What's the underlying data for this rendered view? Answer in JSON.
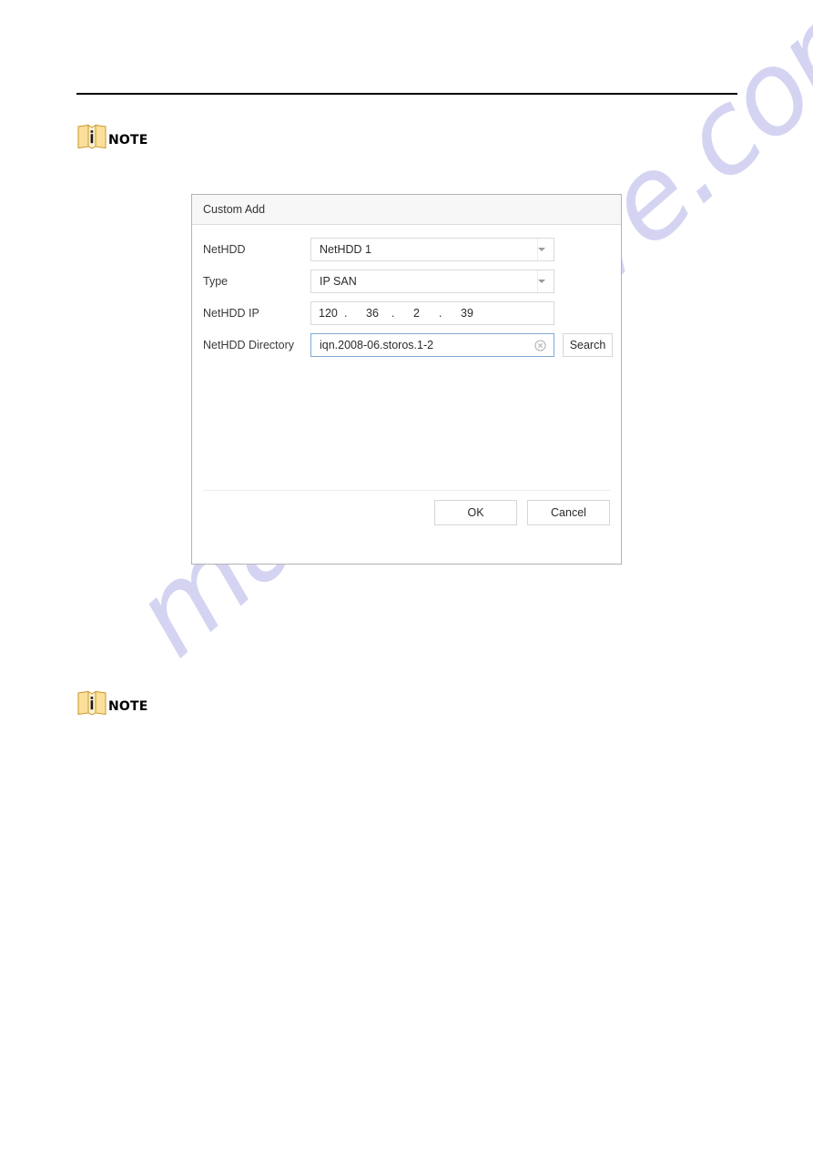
{
  "page": {
    "notes": [
      {
        "id": "note-1",
        "label": "NOTE",
        "icon": "note-book-icon"
      },
      {
        "id": "note-2",
        "label": "NOTE",
        "icon": "note-book-icon"
      }
    ],
    "watermark": "manualshive.com",
    "watermark_color": "#d2d2f2",
    "rule_color": "#000000"
  },
  "dialog": {
    "title": "Custom Add",
    "fields": {
      "nethdd": {
        "label": "NetHDD",
        "value": "NetHDD 1",
        "control": "dropdown",
        "icon": "chevron-down-icon"
      },
      "type": {
        "label": "Type",
        "value": "IP SAN",
        "control": "dropdown",
        "icon": "chevron-down-icon"
      },
      "nethdd_ip": {
        "label": "NetHDD IP",
        "control": "ip-address",
        "octets": [
          "120",
          "36",
          "2",
          "39"
        ],
        "separator": ".",
        "value": "120.36.2.39"
      },
      "nethdd_directory": {
        "label": "NetHDD Directory",
        "value": "iqn.2008-06.storos.1-2",
        "control": "text",
        "clear_icon": "clear-circle-icon",
        "focused": true
      }
    },
    "buttons": {
      "search": "Search",
      "ok": "OK",
      "cancel": "Cancel"
    }
  }
}
